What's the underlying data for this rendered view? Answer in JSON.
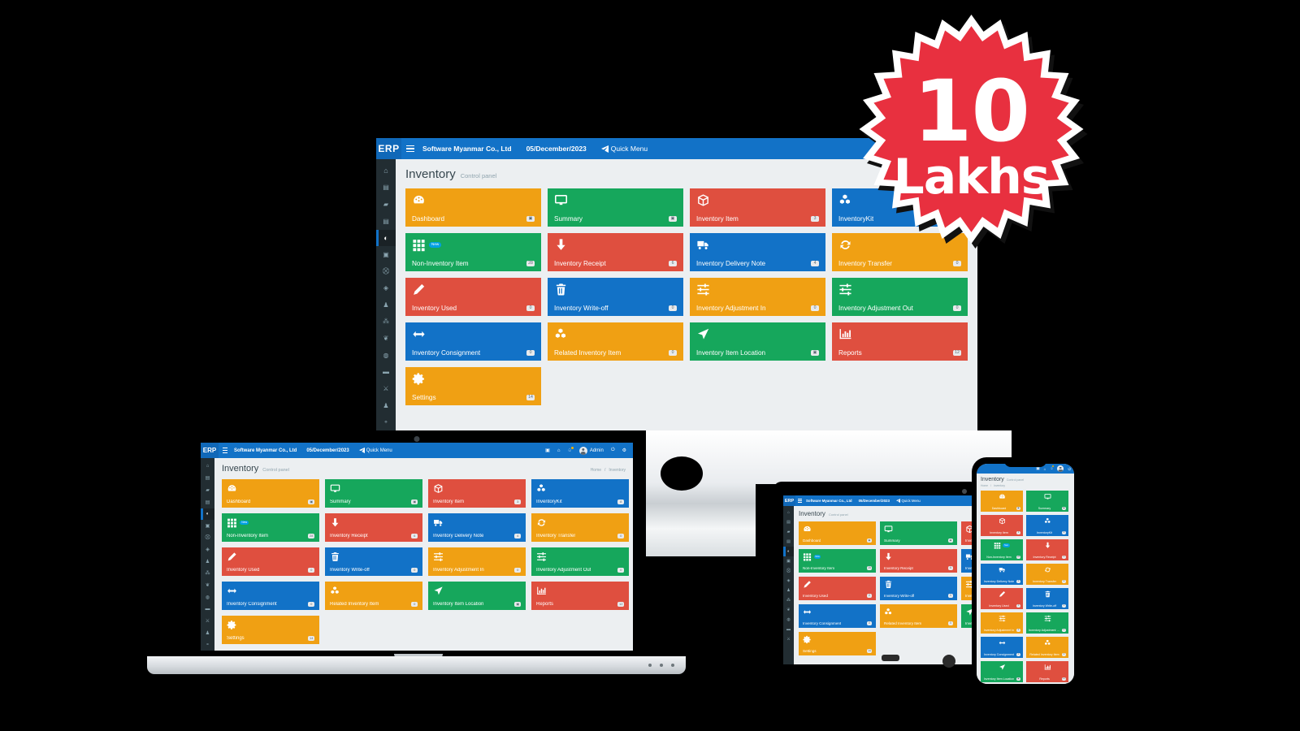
{
  "brand": "ERP",
  "header": {
    "company": "Software Myanmar Co., Ltd",
    "date": "05/December/2023",
    "quick_menu": "Quick Menu",
    "user": "Admin",
    "icons": [
      "menu-icon",
      "calculator-icon",
      "home-icon",
      "bell-icon",
      "avatar",
      "power-icon",
      "gear-icon"
    ]
  },
  "page": {
    "title": "Inventory",
    "subtitle": "Control panel",
    "breadcrumb_home": "Home",
    "breadcrumb_current": "Inventory"
  },
  "colors": {
    "orange": "#f0a013",
    "green": "#16a75c",
    "red": "#df4f3f",
    "blue": "#1272c7",
    "sidebar": "#222d32",
    "topbar": "#1272c7",
    "content_bg": "#eceff1",
    "badge_red": "#e8303f"
  },
  "sidebar": {
    "items": [
      {
        "name": "home-icon",
        "glyph": "⌂"
      },
      {
        "name": "book-icon",
        "glyph": "▤"
      },
      {
        "name": "chart-icon",
        "glyph": "▲"
      },
      {
        "name": "card-icon",
        "glyph": "▧"
      },
      {
        "name": "tag-icon",
        "glyph": "◐",
        "active": true
      },
      {
        "name": "briefcase-icon",
        "glyph": "▣"
      },
      {
        "name": "cart-icon",
        "glyph": "⛒"
      },
      {
        "name": "diamond-icon",
        "glyph": "◆"
      },
      {
        "name": "users-icon",
        "glyph": "♟"
      },
      {
        "name": "share-icon",
        "glyph": "⁂"
      },
      {
        "name": "leaf-icon",
        "glyph": "❦"
      },
      {
        "name": "clock-icon",
        "glyph": "◌"
      },
      {
        "name": "bed-icon",
        "glyph": "▬"
      },
      {
        "name": "cutlery-icon",
        "glyph": "⚔"
      },
      {
        "name": "team-icon",
        "glyph": "♟"
      },
      {
        "name": "person-icon",
        "glyph": "⚬"
      }
    ]
  },
  "tiles": [
    {
      "label": "Dashboard",
      "badge": "▣",
      "color": "orange",
      "icon": "dashboard-gauge-icon",
      "new": false
    },
    {
      "label": "Summary",
      "badge": "▣",
      "color": "green",
      "icon": "monitor-icon",
      "new": false
    },
    {
      "label": "Inventory Item",
      "badge": "3",
      "color": "red",
      "icon": "box-icon",
      "new": false
    },
    {
      "label": "InventoryKit",
      "badge": "8",
      "color": "blue",
      "icon": "cubes-icon",
      "new": false
    },
    {
      "label": "Non-Inventory Item",
      "badge": "28",
      "color": "green",
      "icon": "grid-icon",
      "new": true,
      "new_label": "New"
    },
    {
      "label": "Inventory Receipt",
      "badge": "6",
      "color": "red",
      "icon": "arrow-down-icon",
      "new": false
    },
    {
      "label": "Inventory Delivery Note",
      "badge": "4",
      "color": "blue",
      "icon": "truck-icon",
      "new": false
    },
    {
      "label": "Inventory Transfer",
      "badge": "0",
      "color": "orange",
      "icon": "refresh-icon",
      "new": false
    },
    {
      "label": "Inventory Used",
      "badge": "0",
      "color": "red",
      "icon": "pencil-icon",
      "new": false
    },
    {
      "label": "Inventory Write-off",
      "badge": "0",
      "color": "blue",
      "icon": "trash-icon",
      "new": false
    },
    {
      "label": "Inventory Adjustment In",
      "badge": "0",
      "color": "orange",
      "icon": "sliders-icon",
      "new": false
    },
    {
      "label": "Inventory Adjustment Out",
      "badge": "0",
      "color": "green",
      "icon": "sliders-icon",
      "new": false
    },
    {
      "label": "Inventory Consignment",
      "badge": "0",
      "color": "blue",
      "icon": "arrows-h-icon",
      "new": false
    },
    {
      "label": "Related Inventory Item",
      "badge": "0",
      "color": "orange",
      "icon": "cubes-icon",
      "new": false
    },
    {
      "label": "Inventory Item Location",
      "badge": "▣",
      "color": "green",
      "icon": "location-arrow-icon",
      "new": false
    },
    {
      "label": "Reports",
      "badge": "12",
      "color": "red",
      "icon": "bar-chart-icon",
      "new": false
    },
    {
      "label": "Settings",
      "badge": "14",
      "color": "orange",
      "icon": "gear-icon",
      "new": false
    }
  ],
  "promo_badge": {
    "line1": "10",
    "line2": "Lakhs",
    "fill": "#e8303f",
    "stroke": "#ffffff"
  },
  "devices": [
    "desktop-monitor",
    "laptop",
    "tablet",
    "smartphone"
  ]
}
